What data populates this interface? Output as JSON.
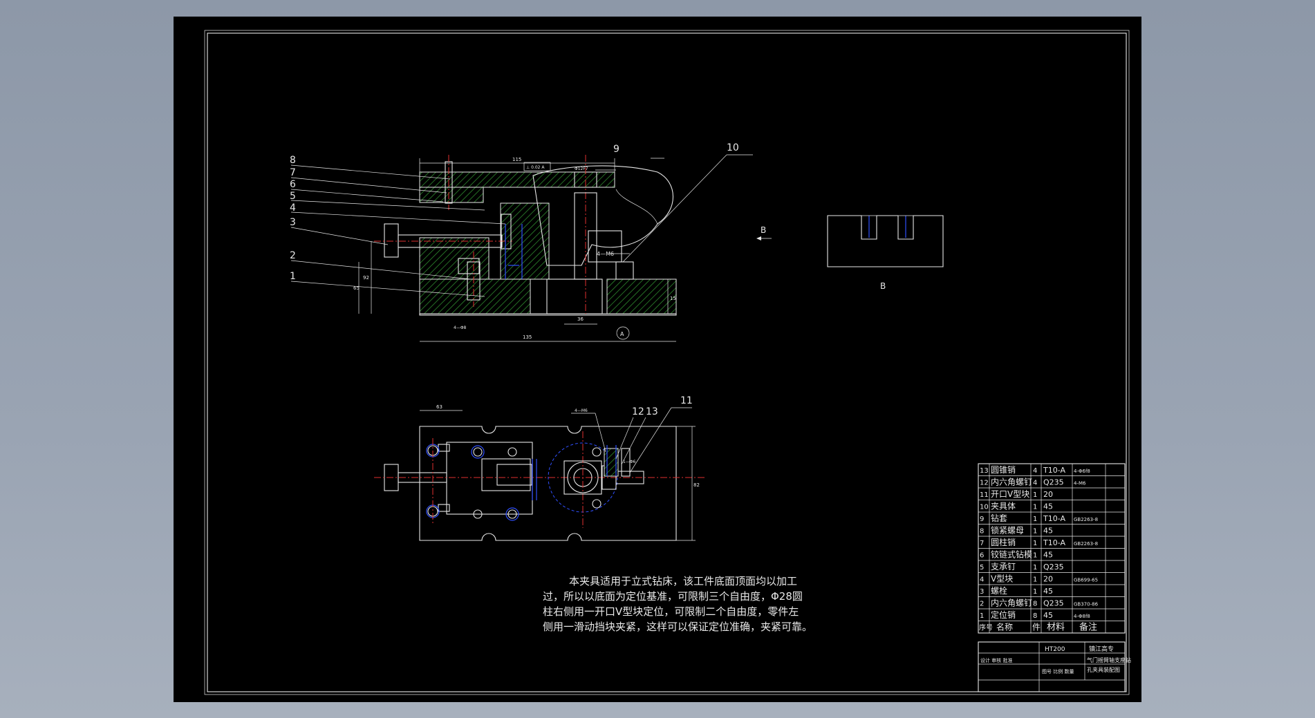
{
  "drawing": {
    "section_label": "B",
    "view_label": "B",
    "note_lines": [
      "本夹具适用于立式钻床，该工件底面顶面均以加工",
      "过，所以以底面为定位基准，可限制三个自由度，Φ28圆",
      "柱右侧用一开口V型块定位，可限制二个自由度，零件左",
      "侧用一滑动挡块夹紧，这样可以保证定位准确，夹紧可靠。"
    ],
    "callouts": [
      "8",
      "7",
      "6",
      "5",
      "4",
      "3",
      "2",
      "1",
      "9",
      "10",
      "11",
      "12",
      "13"
    ],
    "dims": {
      "top_width": "115",
      "bottom_width": "135",
      "hole_dim": "Φ12F7",
      "thread": "4—M6",
      "pin_label": "4—Φ8",
      "left_h1": "92",
      "left_h2": "65",
      "right_h": "15",
      "base_w": "36",
      "plan_w": "63",
      "plan_h": "82",
      "plan_pin": "4—M6",
      "plan_pin2": "1—Φ6"
    },
    "frame_tolerance": "⊥ 0.02 A"
  },
  "bom": {
    "rows": [
      {
        "no": "13",
        "name": "圆锥销",
        "qty": "4",
        "mat": "T10-A",
        "note": "4-Φ6f8"
      },
      {
        "no": "12",
        "name": "内六角螺钉",
        "qty": "4",
        "mat": "Q235",
        "note": "4-M6"
      },
      {
        "no": "11",
        "name": "开口V型块",
        "qty": "1",
        "mat": "20",
        "note": ""
      },
      {
        "no": "10",
        "name": "夹具体",
        "qty": "1",
        "mat": "45",
        "note": ""
      },
      {
        "no": "9",
        "name": "钻套",
        "qty": "1",
        "mat": "T10-A",
        "note": "GB2263-8"
      },
      {
        "no": "8",
        "name": "锁紧螺母",
        "qty": "1",
        "mat": "45",
        "note": ""
      },
      {
        "no": "7",
        "name": "圆柱销",
        "qty": "1",
        "mat": "T10-A",
        "note": "GB2263-8"
      },
      {
        "no": "6",
        "name": "铰链式钻模",
        "qty": "1",
        "mat": "45",
        "note": ""
      },
      {
        "no": "5",
        "name": "支承钉",
        "qty": "1",
        "mat": "Q235",
        "note": ""
      },
      {
        "no": "4",
        "name": "V型块",
        "qty": "1",
        "mat": "20",
        "note": "GB699-65"
      },
      {
        "no": "3",
        "name": "螺栓",
        "qty": "1",
        "mat": "45",
        "note": ""
      },
      {
        "no": "2",
        "name": "内六角螺钉",
        "qty": "8",
        "mat": "Q235",
        "note": "GB370-86"
      },
      {
        "no": "1",
        "name": "定位销",
        "qty": "8",
        "mat": "45",
        "note": "4-Φ8f8"
      }
    ],
    "header": {
      "no": "序号",
      "name": "名称",
      "qty": "件",
      "mat": "材料",
      "note": "备注"
    },
    "title_block": {
      "material": "HT200",
      "school": "镇江高专",
      "part_title": "气门摇臂轴支座钻",
      "part_title2": "孔夹具装配图",
      "left_small": "设计 审核 批准",
      "row_a": "图号 比例 数量"
    }
  }
}
